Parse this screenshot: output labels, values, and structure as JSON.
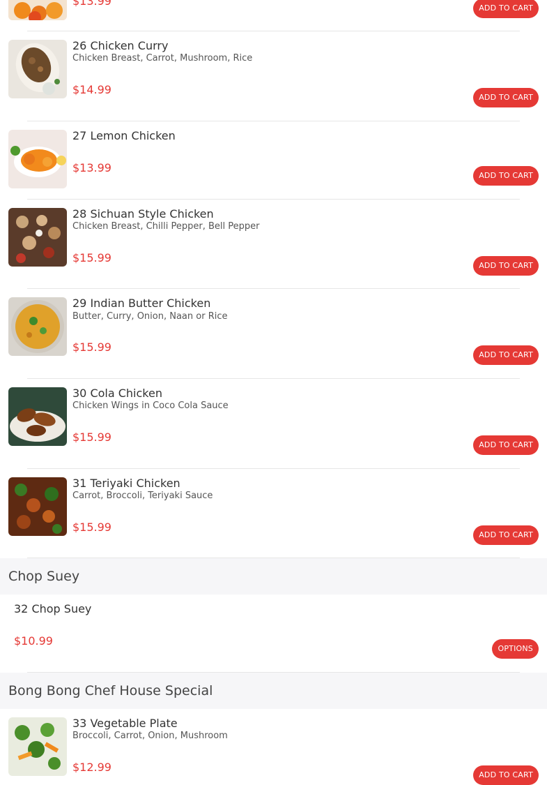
{
  "categories": {
    "chop_suey": "Chop Suey",
    "special": "Bong Bong Chef House Special"
  },
  "items": {
    "prev": {
      "price": "$13.99",
      "button": "ADD TO CART"
    },
    "i26": {
      "name": "26 Chicken Curry",
      "desc": "Chicken Breast, Carrot, Mushroom, Rice",
      "price": "$14.99",
      "button": "ADD TO CART"
    },
    "i27": {
      "name": "27 Lemon Chicken",
      "price": "$13.99",
      "button": "ADD TO CART"
    },
    "i28": {
      "name": "28 Sichuan Style Chicken",
      "desc": "Chicken Breast, Chilli Pepper, Bell Pepper",
      "price": "$15.99",
      "button": "ADD TO CART"
    },
    "i29": {
      "name": "29 Indian Butter Chicken",
      "desc": "Butter, Curry, Onion, Naan or Rice",
      "price": "$15.99",
      "button": "ADD TO CART"
    },
    "i30": {
      "name": "30 Cola Chicken",
      "desc": "Chicken Wings in Coco Cola Sauce",
      "price": "$15.99",
      "button": "ADD TO CART"
    },
    "i31": {
      "name": "31 Teriyaki Chicken",
      "desc": "Carrot, Broccoli, Teriyaki Sauce",
      "price": "$15.99",
      "button": "ADD TO CART"
    },
    "i32": {
      "name": "32 Chop Suey",
      "price": "$10.99",
      "button": "OPTIONS"
    },
    "i33": {
      "name": "33 Vegetable Plate",
      "desc": "Broccoli, Carrot, Onion, Mushroom",
      "price": "$12.99",
      "button": "ADD TO CART"
    }
  },
  "colors": {
    "accent": "#e53935",
    "category_bg": "#f6f6f8",
    "divider": "#e6e6e6"
  }
}
